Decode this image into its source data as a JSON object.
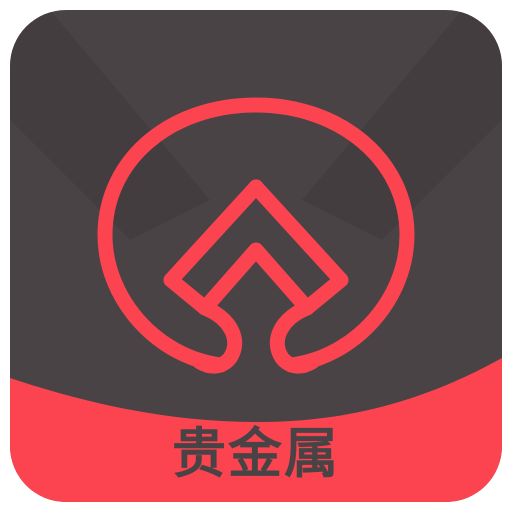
{
  "app_icon": {
    "label": "贵金属",
    "logo_name": "spade-circle-logo",
    "colors": {
      "background": "#4a4346",
      "background_shadow": "#3f393c",
      "accent": "#fc4451",
      "label_text": "#4a4346"
    }
  }
}
